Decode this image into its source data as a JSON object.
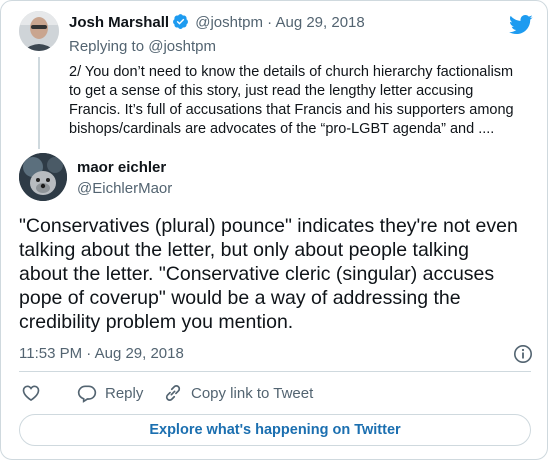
{
  "parent_tweet": {
    "name": "Josh Marshall",
    "handle": "@joshtpm",
    "separator": "·",
    "date": "Aug 29, 2018",
    "replying_to": "Replying to @joshtpm",
    "text_lines": [
      "2/ You don’t need to know the details of church hierarchy factionalism",
      "to get a sense of this story, just read the lengthy letter accusing",
      "Francis. It’s full of accusations that Francis and his supporters among",
      "bishops/cardinals are advocates of the “pro-LGBT agenda” and ...."
    ]
  },
  "main_tweet": {
    "name": "maor eichler",
    "handle": "@EichlerMaor",
    "text_lines": [
      "\"Conservatives (plural) pounce\" indicates they're not even",
      "talking about the letter, but only about people talking",
      "about the letter. \"Conservative cleric (singular) accuses",
      "pope of coverup\" would be a way of addressing the",
      "credibility problem you mention."
    ],
    "timestamp": "11:53 PM · Aug 29, 2018"
  },
  "actions": {
    "reply_label": "Reply",
    "copy_label": "Copy link to Tweet"
  },
  "explore_label": "Explore what's happening on Twitter",
  "icons": [
    "verified-badge-icon",
    "twitter-bird-icon",
    "info-icon",
    "heart-icon",
    "reply-bubble-icon",
    "link-icon"
  ],
  "colors": {
    "brand_blue": "#1d9bf0",
    "text": "#0f1419",
    "muted": "#536471",
    "border": "#cfd9de",
    "link_blue": "#1b6fb0"
  }
}
